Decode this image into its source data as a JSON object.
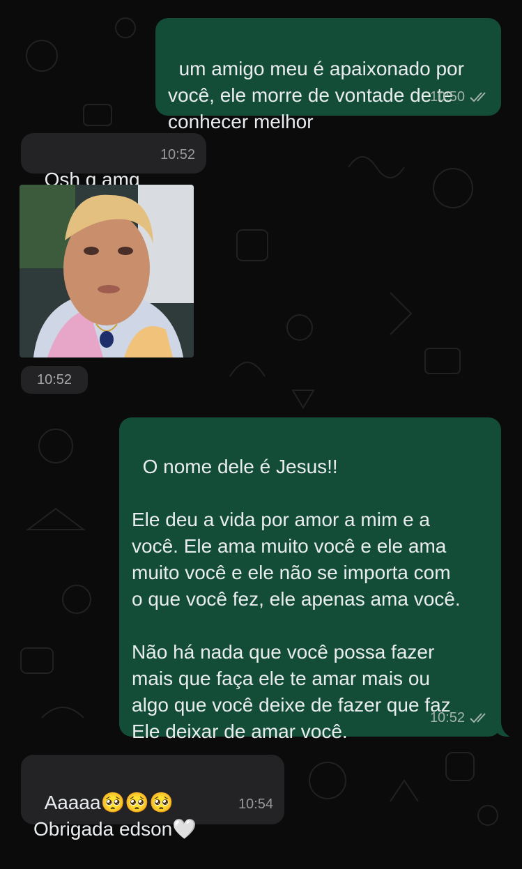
{
  "messages": [
    {
      "id": "m1",
      "direction": "out",
      "text": "um amigo meu é apaixonado por\nvocê, ele morre de vontade de te\nconhecer melhor",
      "time": "10:50",
      "status": "read"
    },
    {
      "id": "m2",
      "direction": "in",
      "text": "Osh q amg",
      "time": "10:52"
    },
    {
      "id": "m3",
      "direction": "in",
      "type": "image",
      "image_description": "",
      "time": "10:52"
    },
    {
      "id": "m4",
      "direction": "out",
      "text": "O nome dele é Jesus!!\n\nEle deu a vida por amor a mim e a\nvocê. Ele ama muito você e ele ama\nmuito você e ele não se importa com\no que você fez, ele apenas ama você.\n\nNão há nada que você possa fazer\nmais que faça ele te amar mais ou\nalgo que você deixe de fazer que faz\nEle deixar de amar você.",
      "time": "10:52",
      "status": "read"
    },
    {
      "id": "m5",
      "direction": "in",
      "text": "Aaaaa🥺🥺🥺\nObrigada edson🤍",
      "time": "10:54"
    }
  ],
  "colors": {
    "outgoing_bubble": "#144d37",
    "incoming_bubble": "#232325",
    "background": "#0b0b0b",
    "read_ticks": "#9fb3aa"
  },
  "icons": {
    "read_receipt": "double-check-icon"
  }
}
